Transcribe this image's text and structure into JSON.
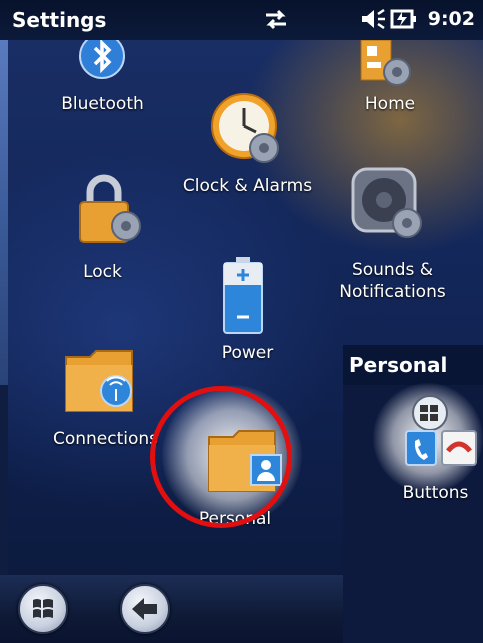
{
  "status_bar": {
    "title": "Settings",
    "time": "9:02",
    "icons": [
      "sync-arrows-icon",
      "volume-icon",
      "battery-charging-icon"
    ]
  },
  "settings_items": [
    {
      "label": "Bluetooth",
      "icon": "bluetooth-icon"
    },
    {
      "label": "Home",
      "icon": "home-icon"
    },
    {
      "label": "Clock & Alarms",
      "icon": "clock-icon"
    },
    {
      "label": "Lock",
      "icon": "lock-icon"
    },
    {
      "label": "Sounds & Notifications",
      "label_line1": "Sounds &",
      "label_line2": "Notifications",
      "icon": "speaker-icon"
    },
    {
      "label": "Power",
      "icon": "battery-icon"
    },
    {
      "label": "Connections",
      "icon": "connections-folder-icon"
    },
    {
      "label": "Personal",
      "icon": "personal-folder-icon"
    }
  ],
  "personal_panel": {
    "title": "Personal",
    "items": [
      {
        "label": "Buttons",
        "icon": "buttons-icon"
      }
    ]
  },
  "taskbar": {
    "buttons": [
      "windows-start-icon",
      "back-arrow-icon"
    ]
  },
  "colors": {
    "highlight_ring": "#e10f0f",
    "folder": "#e8a033",
    "accent_blue": "#2e78d4"
  }
}
